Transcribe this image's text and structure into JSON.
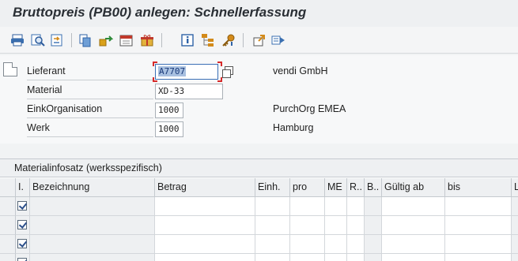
{
  "window": {
    "title": "Bruttopreis  (PB00)  anlegen: Schnellerfassung"
  },
  "toolbar": {
    "buttons": [
      {
        "name": "print-icon",
        "color": "#3a6fb0"
      },
      {
        "name": "search-icon",
        "color": "#3a6fb0"
      },
      {
        "name": "find-next-icon",
        "color": "#d38a1a"
      },
      {
        "name": "copy-icon",
        "color": "#2f63a7"
      },
      {
        "name": "move-icon",
        "color": "#d9a11a"
      },
      {
        "name": "calendar-icon",
        "color": "#c0392b"
      },
      {
        "name": "gift-icon",
        "color": "#c0392b"
      },
      {
        "name": "info-icon",
        "color": "#2f63a7"
      },
      {
        "name": "hierarchy-icon",
        "color": "#d38a1a"
      },
      {
        "name": "key-icon",
        "color": "#d38a1a"
      },
      {
        "name": "export-icon",
        "color": "#d38a1a"
      },
      {
        "name": "next-screen-icon",
        "color": "#3a6fb0"
      }
    ]
  },
  "header": {
    "fields": [
      {
        "label": "Lieferant",
        "value": "A7707",
        "description": "vendi GmbH"
      },
      {
        "label": "Material",
        "value": "XD-33",
        "description": ""
      },
      {
        "label": "EinkOrganisation",
        "value": "1000",
        "description": "PurchOrg EMEA"
      },
      {
        "label": "Werk",
        "value": "1000",
        "description": "Hamburg"
      }
    ]
  },
  "grid": {
    "caption": "Materialinfosatz (werksspezifisch)",
    "columns": [
      "I.",
      "Bezeichnung",
      "Betrag",
      "Einh.",
      "pro",
      "ME",
      "R..",
      "B..",
      "Gültig ab",
      "bis",
      "L"
    ],
    "rows": [
      {
        "checked": true
      },
      {
        "checked": true
      },
      {
        "checked": true
      },
      {
        "checked": true
      }
    ]
  },
  "colors": {
    "accent": "#3b6fb6",
    "focus_corner": "#d62a2a",
    "background": "#f1f3f4"
  }
}
